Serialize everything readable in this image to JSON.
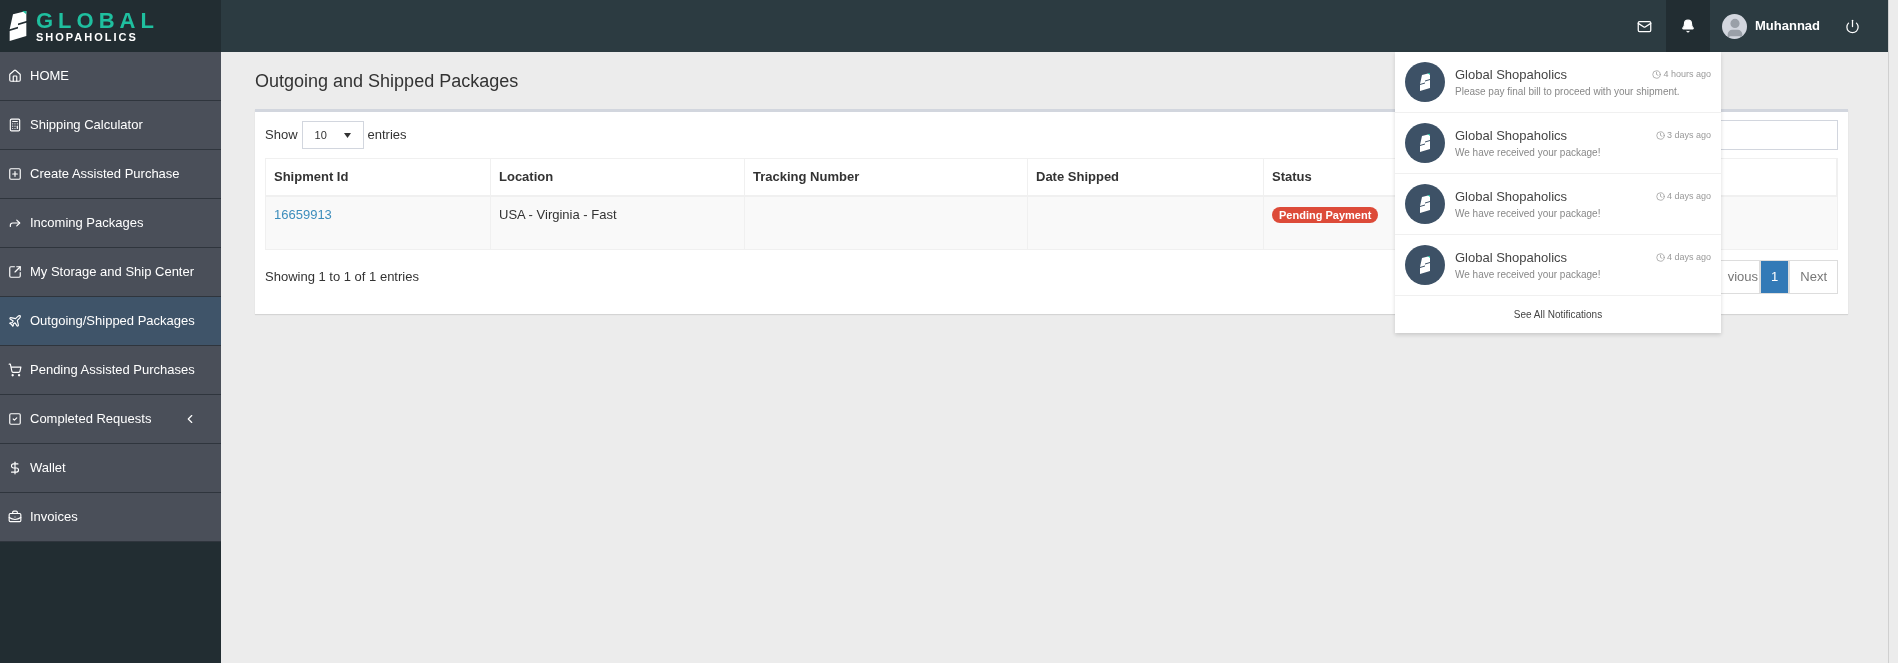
{
  "brand": {
    "name": "GLOBAL",
    "subtitle": "SHOPAHOLICS"
  },
  "sidebar": {
    "items": [
      {
        "label": "HOME",
        "selected": false
      },
      {
        "label": "Shipping Calculator",
        "selected": false
      },
      {
        "label": "Create Assisted Purchase",
        "selected": false
      },
      {
        "label": "Incoming Packages",
        "selected": false
      },
      {
        "label": "My Storage and Ship Center",
        "selected": false
      },
      {
        "label": "Outgoing/Shipped Packages",
        "selected": true
      },
      {
        "label": "Pending Assisted Purchases",
        "selected": false
      },
      {
        "label": "Completed Requests",
        "selected": false,
        "expanded": false
      },
      {
        "label": "Wallet",
        "selected": false
      },
      {
        "label": "Invoices",
        "selected": false
      }
    ]
  },
  "header": {
    "user": {
      "name": "Muhannad"
    }
  },
  "page_title": "Outgoing and Shipped Packages",
  "table": {
    "length": {
      "before": "Show",
      "value": "10",
      "after": "entries"
    },
    "columns": [
      "Shipment Id",
      "Location",
      "Tracking Number",
      "Date Shipped",
      "Status"
    ],
    "rows": [
      {
        "shipment_id": "16659913",
        "location": "USA - Virginia - Fast",
        "status": "Pending Payment"
      }
    ],
    "info": "Showing 1 to 1 of 1 entries",
    "pagination": [
      {
        "label": "vious",
        "selected": false
      },
      {
        "label": "1",
        "selected": true
      },
      {
        "label": "Next",
        "selected": false
      }
    ]
  },
  "notifications": {
    "open": true,
    "items": [
      {
        "title": "Global Shopaholics",
        "message": "Please pay final bill to proceed with your shipment.",
        "time": "4 hours ago"
      },
      {
        "title": "Global Shopaholics",
        "message": "We have received your package!",
        "time": "3 days ago"
      },
      {
        "title": "Global Shopaholics",
        "message": "We have received your package!",
        "time": "4 days ago"
      },
      {
        "title": "Global Shopaholics",
        "message": "We have received your package!",
        "time": "4 days ago"
      }
    ],
    "footer": "See All Notifications"
  }
}
